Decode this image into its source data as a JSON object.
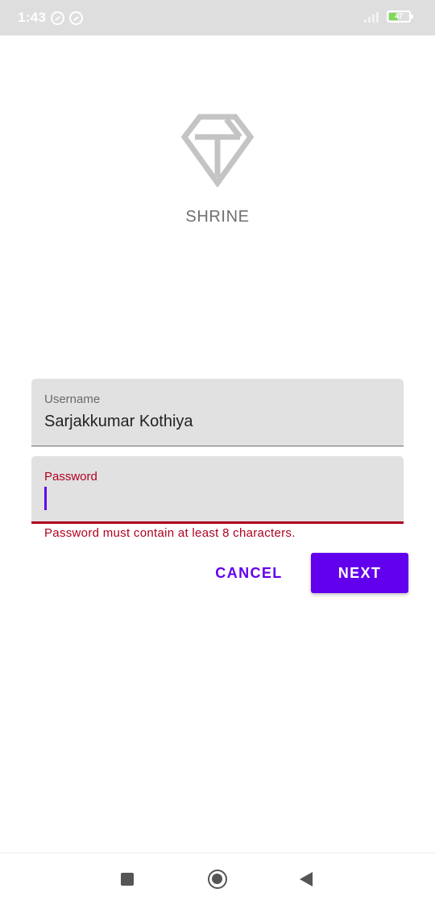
{
  "status_bar": {
    "time": "1:43",
    "battery_level": "47",
    "icons": [
      "notification-icon",
      "sync-icon",
      "signal-icon",
      "battery-icon"
    ]
  },
  "app": {
    "logo_icon": "diamond-icon",
    "brand": "SHRINE"
  },
  "form": {
    "username": {
      "label": "Username",
      "value": "Sarjakkumar Kothiya"
    },
    "password": {
      "label": "Password",
      "value": "",
      "error": "Password must contain at least 8 characters."
    }
  },
  "actions": {
    "cancel_label": "CANCEL",
    "next_label": "NEXT"
  },
  "nav_bar": {
    "icons": [
      "recents-icon",
      "home-icon",
      "back-icon"
    ]
  },
  "colors": {
    "primary": "#6200ee",
    "error": "#b00020",
    "field_background": "#e1e1e1",
    "status_bar": "#dedede"
  }
}
